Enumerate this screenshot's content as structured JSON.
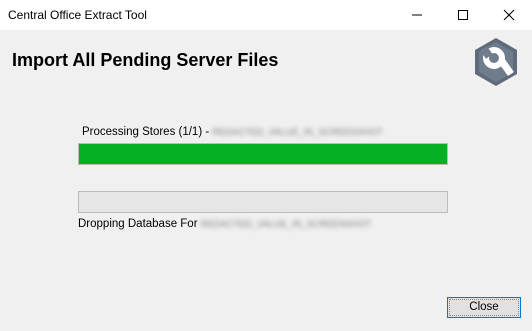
{
  "window": {
    "title": "Central Office Extract Tool",
    "controls": {
      "minimize_icon": "minimize-icon",
      "maximize_icon": "maximize-icon",
      "close_icon": "close-icon"
    }
  },
  "header": {
    "title": "Import All Pending Server Files",
    "logo_icon": "wrench-gear-icon"
  },
  "progress": {
    "stores_label": "Processing Stores (1/1) -",
    "stores_redacted": "REDACTED_VALUE_IN_SCREENSHOT",
    "stores_fraction": 1.0,
    "db_label": "Dropping Database For",
    "db_redacted": "REDACTED_VALUE_IN_SCREENSHOT",
    "db_fraction": 0.0
  },
  "footer": {
    "close_label": "Close"
  },
  "colors": {
    "progress_fill": "#06b025",
    "button_border": "#0078d7"
  }
}
